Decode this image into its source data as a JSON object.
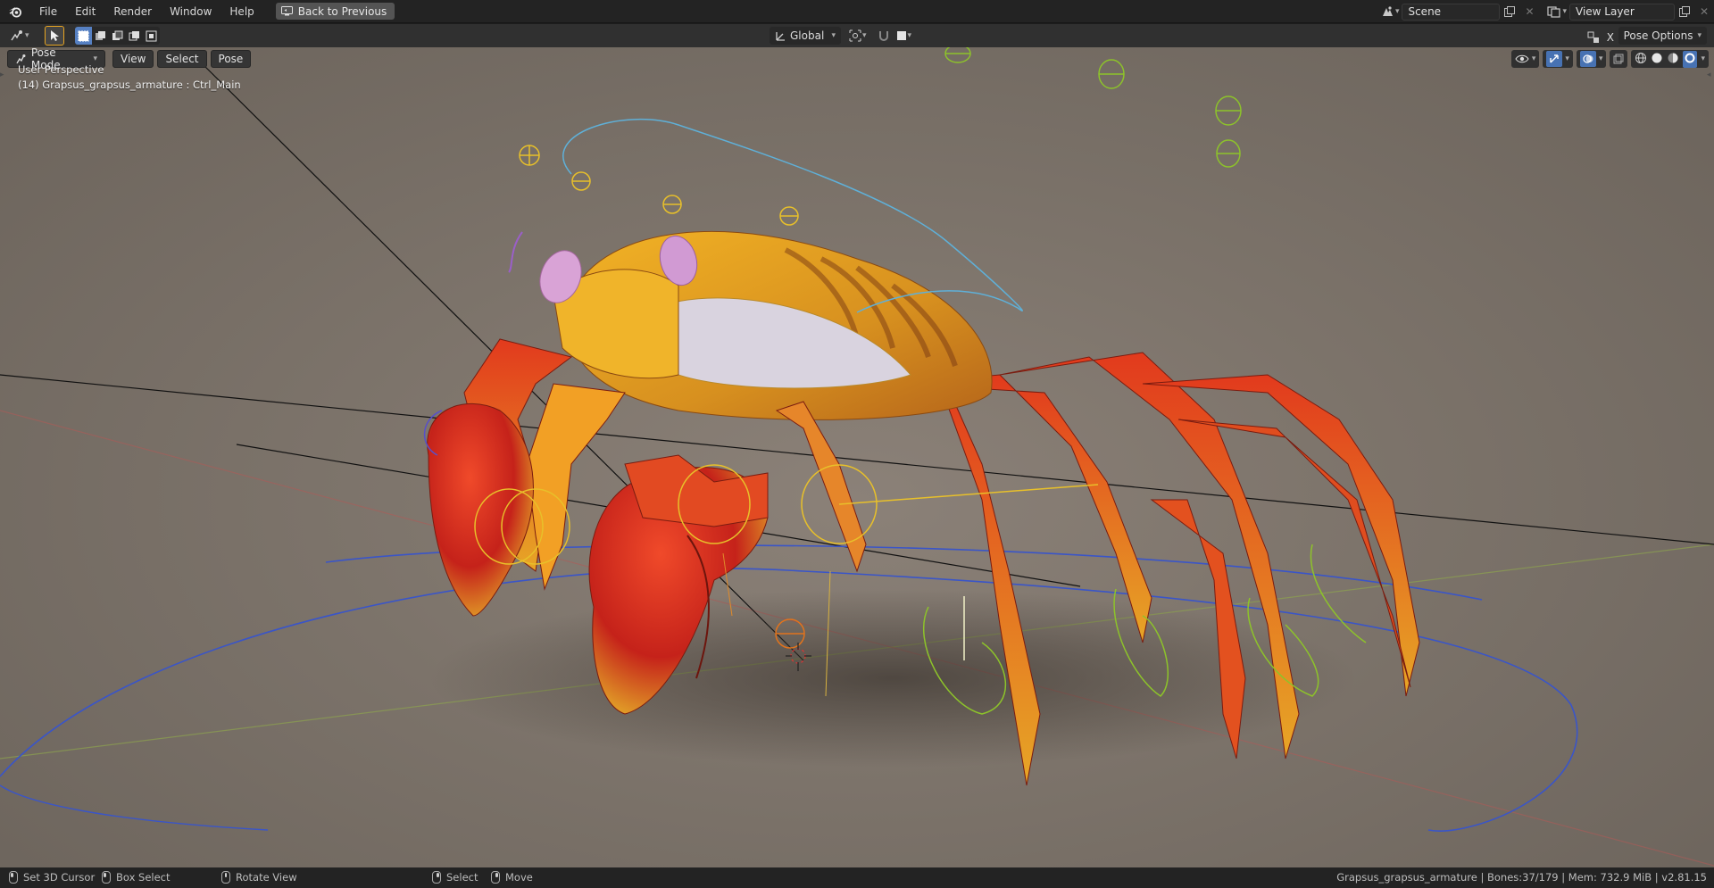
{
  "topbar": {
    "menus": [
      "File",
      "Edit",
      "Render",
      "Window",
      "Help"
    ],
    "back_label": "Back to Previous",
    "scene_name": "Scene",
    "view_layer": "View Layer"
  },
  "header": {
    "orientation": "Global"
  },
  "viewport": {
    "mode": "Pose Mode",
    "menus": [
      "View",
      "Select",
      "Pose"
    ],
    "perspective": "User Perspective",
    "object_info": "(14) Grapsus_grapsus_armature : Ctrl_Main",
    "pose_options": "Pose Options",
    "x_label": "X"
  },
  "statusbar": {
    "set_cursor": "Set 3D Cursor",
    "box_select": "Box Select",
    "rotate_view": "Rotate View",
    "select": "Select",
    "move": "Move",
    "info": "Grapsus_grapsus_armature | Bones:37/179 | Mem: 732.9 MiB | v2.81.15"
  },
  "colors": {
    "accent": "#5680c2",
    "viewport_bg": "#7c736a",
    "crab_red": "#d8321c",
    "crab_yellow": "#e8a521"
  },
  "icons": [
    "blender-logo-icon",
    "editor-type-icon",
    "select-tool-icon",
    "transform-orientation-icon",
    "pivot-icon",
    "snap-icon",
    "visibility-icon",
    "gizmo-icon",
    "overlay-icon",
    "xray-icon",
    "shading-wireframe-icon",
    "shading-solid-icon",
    "shading-material-icon",
    "shading-rendered-icon",
    "new-scene-icon",
    "close-icon",
    "mouse-icon"
  ]
}
